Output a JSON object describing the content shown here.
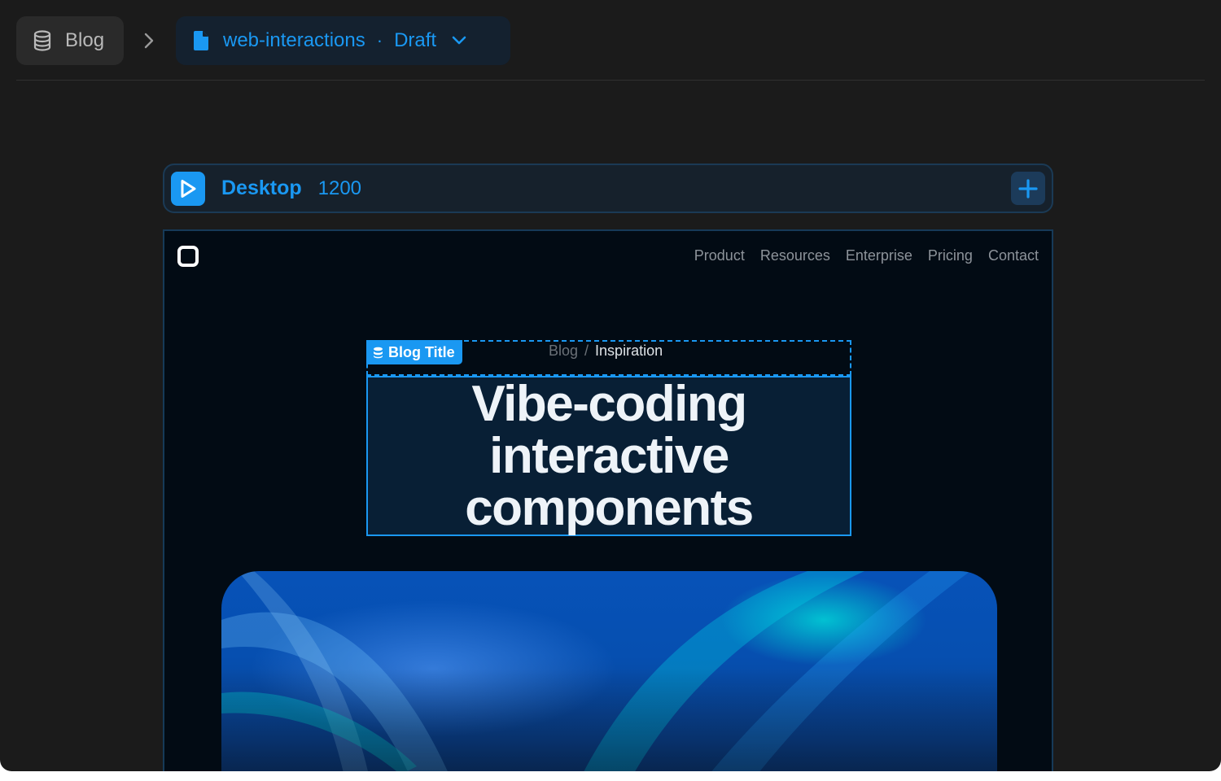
{
  "breadcrumb": {
    "collection": {
      "label": "Blog",
      "icon": "database-icon"
    },
    "separator_icon": "chevron-right-icon",
    "page": {
      "label": "web-interactions",
      "separator": "·",
      "status": "Draft",
      "icon": "file-icon",
      "dropdown_icon": "chevron-down-icon"
    }
  },
  "breakpoint": {
    "name": "Desktop",
    "width": "1200",
    "icon": "play-icon",
    "add_icon": "plus-icon"
  },
  "site": {
    "nav": [
      "Product",
      "Resources",
      "Enterprise",
      "Pricing",
      "Contact"
    ],
    "selection_tag": "Blog Title",
    "post_breadcrumb": {
      "parent": "Blog",
      "separator": "/",
      "current": "Inspiration"
    },
    "title": "Vibe-coding interactive components"
  },
  "colors": {
    "accent": "#1a98f2",
    "app_background": "#1b1b1b",
    "canvas_background": "#020b14"
  }
}
